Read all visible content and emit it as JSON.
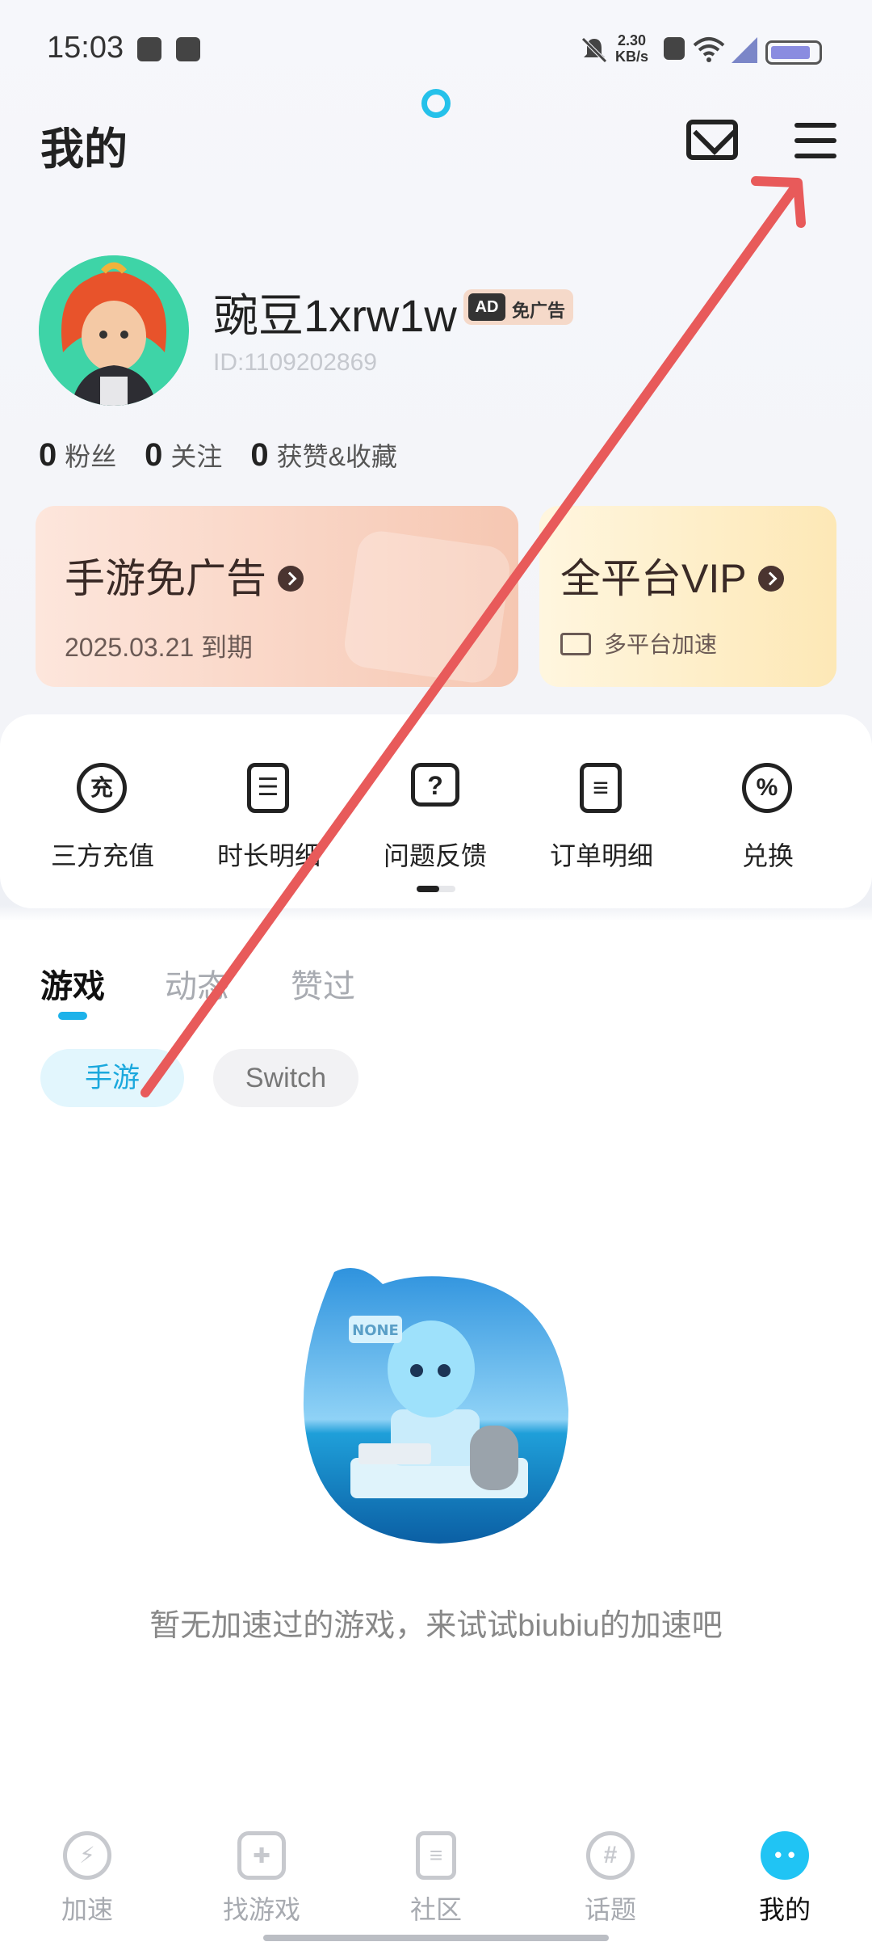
{
  "status_bar": {
    "time": "15:03",
    "net_speed_value": "2.30",
    "net_speed_unit": "KB/s",
    "battery_level": 0.75
  },
  "header": {
    "title": "我的",
    "mail_icon": "mail-icon",
    "menu_icon": "menu-icon"
  },
  "profile": {
    "username": "豌豆1xrw1w",
    "badge_ad": "AD",
    "badge_text": "免广告",
    "user_id": "ID:1109202869"
  },
  "stats": [
    {
      "count": "0",
      "label": "粉丝"
    },
    {
      "count": "0",
      "label": "关注"
    },
    {
      "count": "0",
      "label": "获赞&收藏"
    }
  ],
  "cards": {
    "ad_free": {
      "title": "手游免广告",
      "subtitle": "2025.03.21 到期"
    },
    "vip": {
      "title": "全平台VIP",
      "subtitle": "多平台加速"
    }
  },
  "services": [
    {
      "label": "三方充值",
      "glyph": "充",
      "icon": "recharge-icon"
    },
    {
      "label": "时长明细",
      "glyph": "☰",
      "icon": "duration-list-icon"
    },
    {
      "label": "问题反馈",
      "glyph": "?",
      "icon": "feedback-icon"
    },
    {
      "label": "订单明细",
      "glyph": "≡",
      "icon": "order-icon"
    },
    {
      "label": "兑换",
      "glyph": "%",
      "icon": "redeem-icon"
    }
  ],
  "tabs": [
    "游戏",
    "动态",
    "赞过"
  ],
  "chips": [
    "手游",
    "Switch"
  ],
  "empty": {
    "badge": "NONE",
    "message": "暂无加速过的游戏，来试试biubiu的加速吧"
  },
  "bottom_nav": [
    {
      "label": "加速",
      "icon": "lightning-icon",
      "glyph": "⚡"
    },
    {
      "label": "找游戏",
      "icon": "gamepad-icon",
      "glyph": "✚"
    },
    {
      "label": "社区",
      "icon": "document-icon",
      "glyph": "≡"
    },
    {
      "label": "话题",
      "icon": "hashtag-icon",
      "glyph": "#"
    },
    {
      "label": "我的",
      "icon": "profile-mascot-icon",
      "glyph": "• •"
    }
  ],
  "colors": {
    "accent": "#20c4f4",
    "annotation_arrow": "#e85a5a"
  }
}
